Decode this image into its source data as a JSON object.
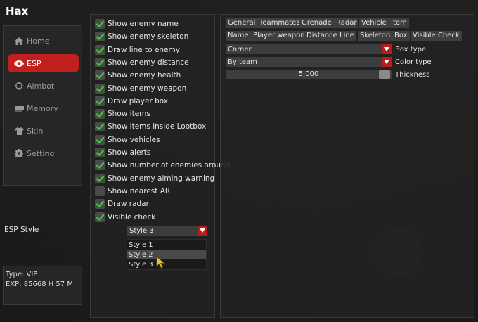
{
  "app": {
    "title": "Hax"
  },
  "sidebar": {
    "items": [
      {
        "label": "Home",
        "icon": "home-icon"
      },
      {
        "label": "ESP",
        "icon": "eye-icon",
        "active": true
      },
      {
        "label": "Aimbot",
        "icon": "crosshair-icon"
      },
      {
        "label": "Memory",
        "icon": "memory-icon"
      },
      {
        "label": "Skin",
        "icon": "shirt-icon"
      },
      {
        "label": "Setting",
        "icon": "gear-icon"
      }
    ]
  },
  "info": {
    "type": "Type: VIP",
    "exp": "EXP: 85668 H 57 M"
  },
  "options": [
    {
      "label": "Show enemy name",
      "checked": true
    },
    {
      "label": "Show enemy skeleton",
      "checked": true
    },
    {
      "label": "Draw line to enemy",
      "checked": true
    },
    {
      "label": "Show enemy distance",
      "checked": true
    },
    {
      "label": "Show enemy health",
      "checked": true
    },
    {
      "label": "Show enemy weapon",
      "checked": true
    },
    {
      "label": "Draw player box",
      "checked": true
    },
    {
      "label": "Show items",
      "checked": true
    },
    {
      "label": "Show items inside Lootbox",
      "checked": true
    },
    {
      "label": "Show vehicles",
      "checked": true
    },
    {
      "label": "Show alerts",
      "checked": true
    },
    {
      "label": "Show number of enemies around",
      "checked": true
    },
    {
      "label": "Show enemy aiming warning",
      "checked": true
    },
    {
      "label": "Show nearest AR",
      "checked": false
    },
    {
      "label": "Draw radar",
      "checked": true
    },
    {
      "label": "Visible check",
      "checked": true
    }
  ],
  "esp_style": {
    "label": "ESP Style",
    "value": "Style 3",
    "options": [
      "Style 1",
      "Style 2",
      "Style 3"
    ],
    "hovered": "Style 2"
  },
  "tabs_row1": [
    "General",
    "Teammates",
    "Grenade",
    "Radar",
    "Vehicle",
    "Item"
  ],
  "tabs_row2": [
    "Name",
    "Player weapon",
    "Distance",
    "Line",
    "Skeleton",
    "Box",
    "Visible Check"
  ],
  "box_settings": {
    "box_type": {
      "value": "Corner",
      "label": "Box type"
    },
    "color_type": {
      "value": "By team",
      "label": "Color type"
    },
    "thickness": {
      "value": "5,000",
      "label": "Thickness"
    }
  },
  "colors": {
    "accent": "#c0211f",
    "panel": "#222222",
    "control": "#3d3d3d"
  }
}
